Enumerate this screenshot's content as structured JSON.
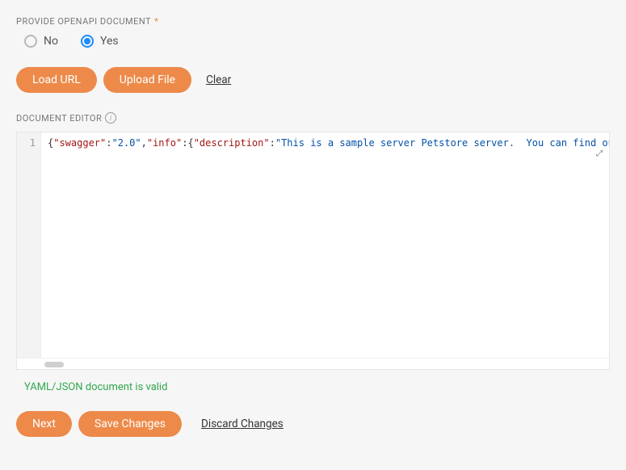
{
  "provide": {
    "label": "PROVIDE OPENAPI DOCUMENT",
    "required_mark": "*",
    "options": {
      "no": "No",
      "yes": "Yes"
    },
    "selected": "yes"
  },
  "actions": {
    "load_url": "Load URL",
    "upload_file": "Upload File",
    "clear": "Clear"
  },
  "editor": {
    "label": "DOCUMENT EDITOR",
    "line_number": "1",
    "code_tokens": [
      {
        "type": "brace",
        "text": "{"
      },
      {
        "type": "key",
        "text": "\"swagger\""
      },
      {
        "type": "colon",
        "text": ":"
      },
      {
        "type": "str",
        "text": "\"2.0\""
      },
      {
        "type": "comma",
        "text": ","
      },
      {
        "type": "key",
        "text": "\"info\""
      },
      {
        "type": "colon",
        "text": ":"
      },
      {
        "type": "brace",
        "text": "{"
      },
      {
        "type": "key",
        "text": "\"description\""
      },
      {
        "type": "colon",
        "text": ":"
      },
      {
        "type": "str",
        "text": "\"This is a sample server Petstore server.  You can find ou"
      }
    ]
  },
  "validation": {
    "message": "YAML/JSON document is valid"
  },
  "footer": {
    "next": "Next",
    "save": "Save Changes",
    "discard": "Discard Changes"
  }
}
